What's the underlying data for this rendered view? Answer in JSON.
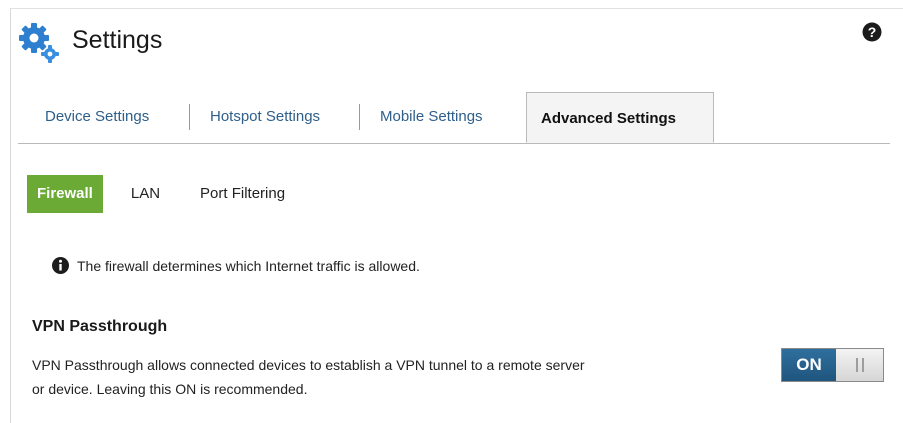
{
  "header": {
    "title": "Settings",
    "logo_icon": "gears-icon",
    "help_icon": "help-icon"
  },
  "tabs": [
    {
      "label": "Device Settings",
      "active": false
    },
    {
      "label": "Hotspot Settings",
      "active": false
    },
    {
      "label": "Mobile Settings",
      "active": false
    },
    {
      "label": "Advanced Settings",
      "active": true
    }
  ],
  "subtabs": [
    {
      "label": "Firewall",
      "active": true
    },
    {
      "label": "LAN",
      "active": false
    },
    {
      "label": "Port Filtering",
      "active": false
    }
  ],
  "info": {
    "icon": "info-icon",
    "text": "The firewall determines which Internet traffic is allowed."
  },
  "vpn": {
    "title": "VPN Passthrough",
    "description_line1": "VPN Passthrough allows connected devices to establish a VPN tunnel to a remote server",
    "description_line2": "or device. Leaving this ON is recommended.",
    "toggle_label": "ON",
    "toggle_state": true
  },
  "colors": {
    "accent_green": "#6aaa35",
    "toggle_blue": "#24608c",
    "tab_link": "#2d5f8a",
    "gear_blue": "#2f7fd0"
  }
}
